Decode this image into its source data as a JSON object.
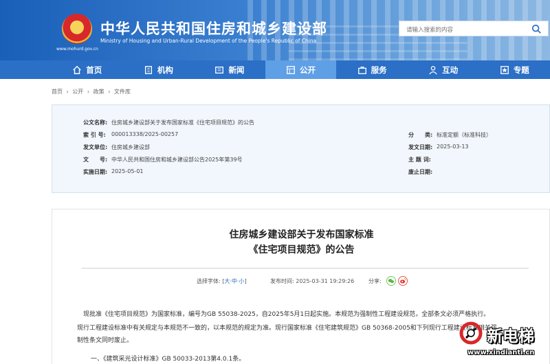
{
  "header": {
    "title": "中华人民共和国住房和城乡建设部",
    "subtitle": "Ministry of Housing and Urban-Rural Development of the People's Republic of China",
    "emblem_url": "www.mohurd.gov.cn",
    "search_placeholder": "请输入搜索的内容",
    "brand_color": "#1a5fb8"
  },
  "nav": {
    "items": [
      {
        "label": "首页",
        "icon": "home-icon"
      },
      {
        "label": "机构",
        "icon": "building-icon"
      },
      {
        "label": "新闻",
        "icon": "news-icon"
      },
      {
        "label": "公开",
        "icon": "open-icon",
        "active": true
      },
      {
        "label": "服务",
        "icon": "service-icon"
      },
      {
        "label": "互动",
        "icon": "interact-icon"
      },
      {
        "label": "专题",
        "icon": "topic-icon"
      }
    ]
  },
  "breadcrumb": [
    "首页",
    "›",
    "公开",
    "›",
    "政策",
    "›",
    "文件库"
  ],
  "meta": {
    "name_label": "公文名称:",
    "name_value": "住房城乡建设部关于发布国家标准《住宅项目规范》的公告",
    "index_label": "索 引 号:",
    "index_value": "000013338/2025-00257",
    "category_label": "分　　类:",
    "category_value": "标准定额（标准科技）",
    "issuer_label": "发文单位:",
    "issuer_value": "住房城乡建设部",
    "date_label": "发文日期:",
    "date_value": "2025-03-13",
    "docno_label": "文　　号:",
    "docno_value": "中华人民共和国住房和城乡建设部公告2025年第39号",
    "subject_label": "主 题 词:",
    "subject_value": "",
    "effective_label": "实施日期:",
    "effective_value": "2025-05-01",
    "repeal_label": "废止日期:",
    "repeal_value": ""
  },
  "article": {
    "title_line1": "住房城乡建设部关于发布国家标准",
    "title_line2": "《住宅项目规范》的公告",
    "font_label": "选择字体:",
    "font_open": "[",
    "font_large": "大",
    "font_sep1": "·",
    "font_medium": "中",
    "font_sep2": "·",
    "font_small": "小",
    "font_close": "]",
    "pub_label": "发布时间:",
    "pub_value": "2025-03-31 19:29:26",
    "share_label": "分享:",
    "para1": "现批准《住宅项目规范》为国家标准，编号为GB 55038-2025，自2025年5月1日起实施。本规范为强制性工程建设规范，全部条文必须严格执行。",
    "para2": "现行工程建设标准中有关规定与本规范不一致的，以本规范的规定为准。现行国家标准《住宅建筑规范》GB 50368-2005和下列现行工程建设标准相关强",
    "para3": "制性条文同时废止。",
    "para4": "一、《建筑采光设计标准》GB 50033-2013第4.0.1条。"
  },
  "watermark": {
    "text": "新电梯",
    "url": "www.xindianti.cn"
  }
}
